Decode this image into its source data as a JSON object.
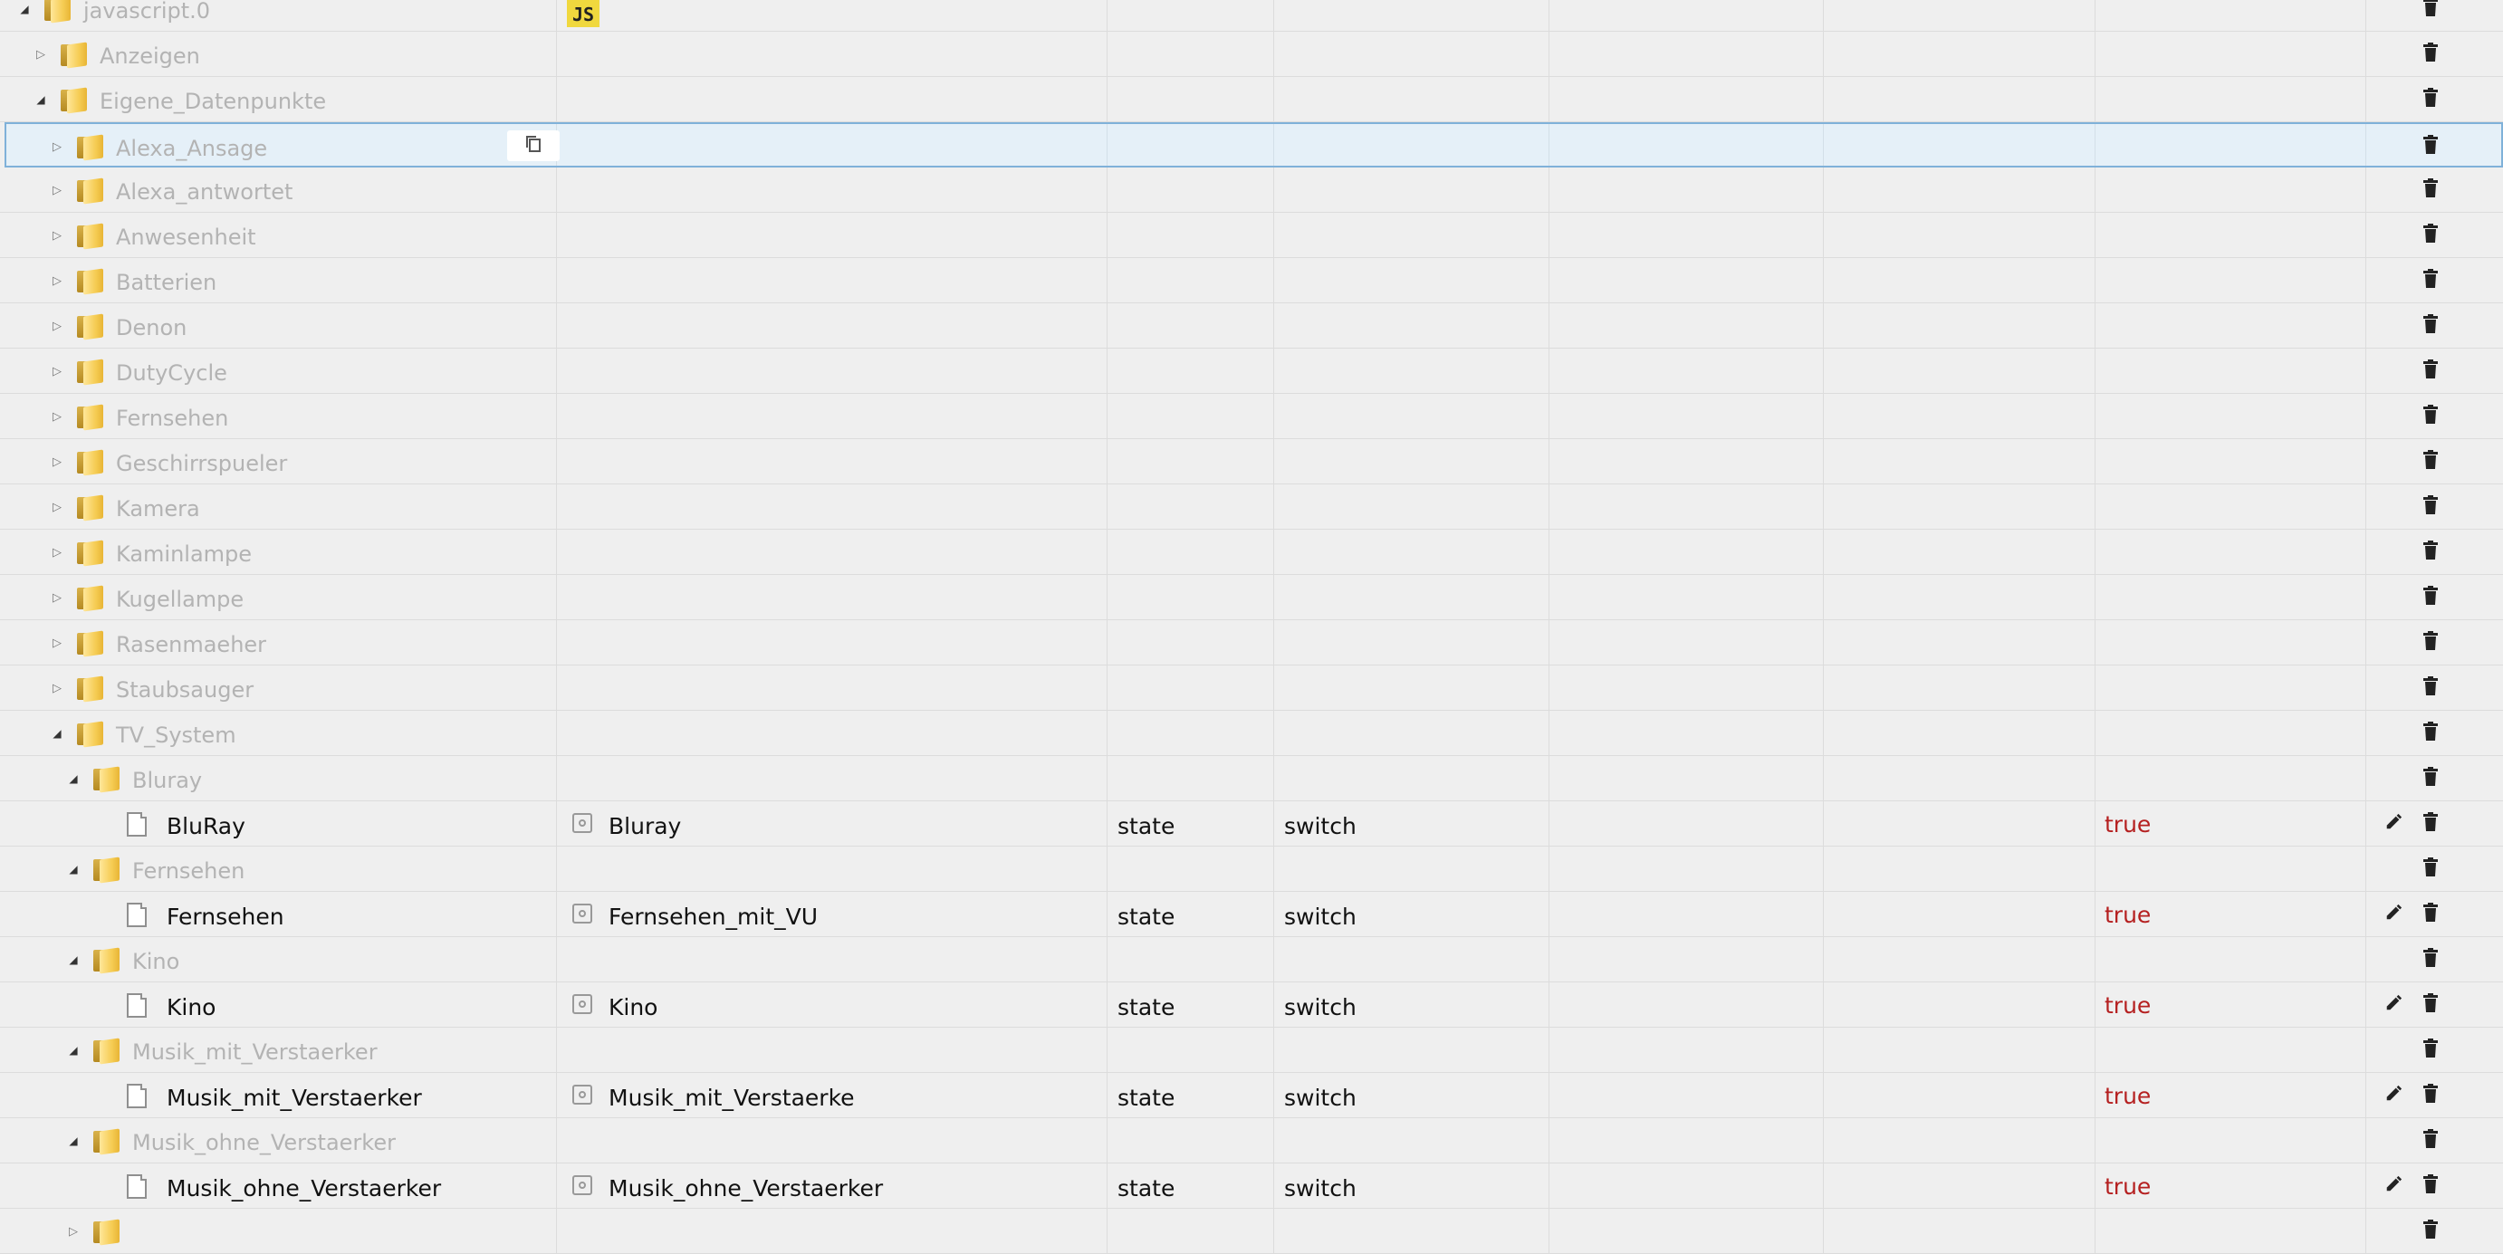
{
  "rows": [
    {
      "name": "javascript.0",
      "type": "folder",
      "level": 0,
      "expanded": true,
      "badge": "JS"
    },
    {
      "name": "Anzeigen",
      "type": "folder",
      "level": 1,
      "expanded": false
    },
    {
      "name": "Eigene_Datenpunkte",
      "type": "folder",
      "level": 1,
      "expanded": true
    },
    {
      "name": "Alexa_Ansage",
      "type": "folder",
      "level": 2,
      "expanded": false,
      "selected": true
    },
    {
      "name": "Alexa_antwortet",
      "type": "folder",
      "level": 2,
      "expanded": false
    },
    {
      "name": "Anwesenheit",
      "type": "folder",
      "level": 2,
      "expanded": false
    },
    {
      "name": "Batterien",
      "type": "folder",
      "level": 2,
      "expanded": false
    },
    {
      "name": "Denon",
      "type": "folder",
      "level": 2,
      "expanded": false
    },
    {
      "name": "DutyCycle",
      "type": "folder",
      "level": 2,
      "expanded": false
    },
    {
      "name": "Fernsehen",
      "type": "folder",
      "level": 2,
      "expanded": false
    },
    {
      "name": "Geschirrspueler",
      "type": "folder",
      "level": 2,
      "expanded": false
    },
    {
      "name": "Kamera",
      "type": "folder",
      "level": 2,
      "expanded": false
    },
    {
      "name": "Kaminlampe",
      "type": "folder",
      "level": 2,
      "expanded": false
    },
    {
      "name": "Kugellampe",
      "type": "folder",
      "level": 2,
      "expanded": false
    },
    {
      "name": "Rasenmaeher",
      "type": "folder",
      "level": 2,
      "expanded": false
    },
    {
      "name": "Staubsauger",
      "type": "folder",
      "level": 2,
      "expanded": false
    },
    {
      "name": "TV_System",
      "type": "folder",
      "level": 2,
      "expanded": true
    },
    {
      "name": "Bluray",
      "type": "folder",
      "level": 3,
      "expanded": true
    },
    {
      "name": "BluRay",
      "type": "state",
      "level": 4,
      "display_name": "Bluray",
      "obj_type": "state",
      "role": "switch",
      "value": "true"
    },
    {
      "name": "Fernsehen",
      "type": "folder",
      "level": 3,
      "expanded": true
    },
    {
      "name": "Fernsehen",
      "type": "state",
      "level": 4,
      "display_name": "Fernsehen_mit_VU",
      "obj_type": "state",
      "role": "switch",
      "value": "true"
    },
    {
      "name": "Kino",
      "type": "folder",
      "level": 3,
      "expanded": true
    },
    {
      "name": "Kino",
      "type": "state",
      "level": 4,
      "display_name": "Kino",
      "obj_type": "state",
      "role": "switch",
      "value": "true"
    },
    {
      "name": "Musik_mit_Verstaerker",
      "type": "folder",
      "level": 3,
      "expanded": true
    },
    {
      "name": "Musik_mit_Verstaerker",
      "type": "state",
      "level": 4,
      "display_name": "Musik_mit_Verstaerke",
      "obj_type": "state",
      "role": "switch",
      "value": "true"
    },
    {
      "name": "Musik_ohne_Verstaerker",
      "type": "folder",
      "level": 3,
      "expanded": true
    },
    {
      "name": "Musik_ohne_Verstaerker",
      "type": "state",
      "level": 4,
      "display_name": "Musik_ohne_Verstaerker",
      "obj_type": "state",
      "role": "switch",
      "value": "true"
    },
    {
      "name": "",
      "type": "folder",
      "level": 3,
      "expanded": false
    }
  ],
  "icons": {
    "expanded": "triangle-down-icon",
    "collapsed": "triangle-right-icon",
    "folder": "folder-icon",
    "file": "file-icon",
    "role": "state-role-icon",
    "copy": "copy-icon",
    "edit": "pencil-icon",
    "delete": "trash-icon"
  },
  "colors": {
    "value": "#b52020",
    "folder_text": "#b3b3b3",
    "selected_row": "#e5f0f8",
    "js_badge": "#f0d83e"
  }
}
